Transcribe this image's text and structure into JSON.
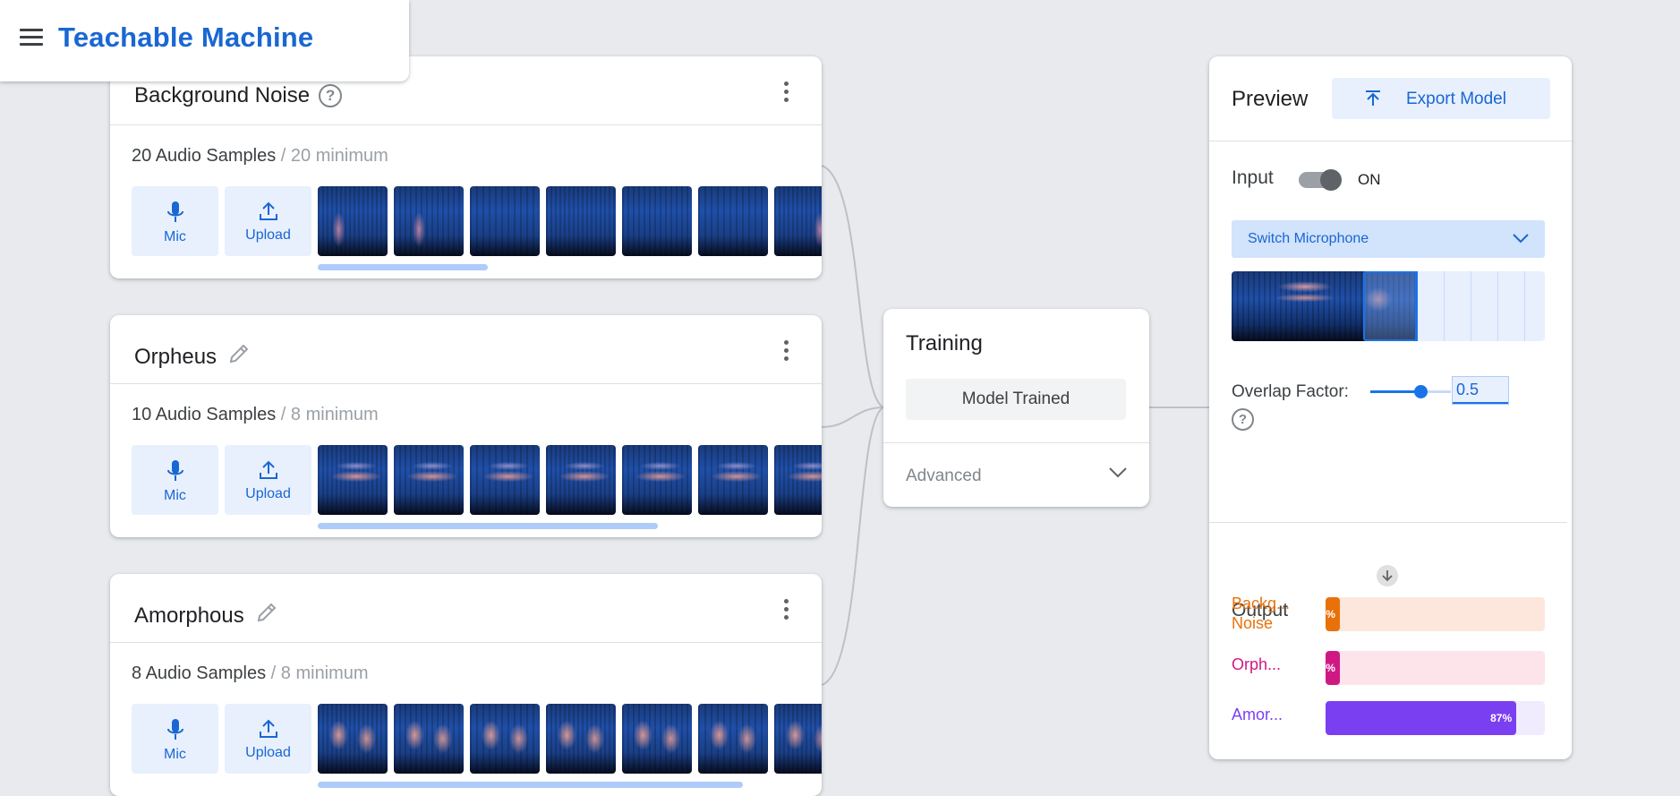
{
  "app": {
    "title": "Teachable Machine"
  },
  "classes": [
    {
      "name": "Background Noise",
      "icon": "help-icon",
      "count_text": "20 Audio Samples",
      "min_text": " / 20 minimum",
      "mic_label": "Mic",
      "upload_label": "Upload",
      "theme": "noise"
    },
    {
      "name": "Orpheus",
      "icon": "pencil-icon",
      "count_text": "10 Audio Samples",
      "min_text": " / 8 minimum",
      "mic_label": "Mic",
      "upload_label": "Upload",
      "theme": "voice"
    },
    {
      "name": "Amorphous",
      "icon": "pencil-icon",
      "count_text": "8 Audio Samples",
      "min_text": " / 8 minimum",
      "mic_label": "Mic",
      "upload_label": "Upload",
      "theme": "voice2"
    }
  ],
  "training": {
    "title": "Training",
    "status_button": "Model Trained",
    "advanced_label": "Advanced"
  },
  "preview": {
    "title": "Preview",
    "export_label": "Export Model",
    "input_label": "Input",
    "input_state": "ON",
    "microphone_select": "Switch Microphone",
    "overlap_label": "Overlap Factor:",
    "overlap_value": "0.5",
    "output_label": "Output",
    "outputs": [
      {
        "name": "Backg... Noise",
        "value_text": "%",
        "fraction": 0.05,
        "color": "#e8710a",
        "bg": "#fde7dc"
      },
      {
        "name": "Orph...",
        "value_text": "%",
        "fraction": 0.04,
        "color": "#d01884",
        "bg": "#fce4ea"
      },
      {
        "name": "Amor...",
        "value_text": "87%",
        "fraction": 0.87,
        "color": "#7b3ff2",
        "bg": "#f1ebfe"
      }
    ]
  },
  "colors": {
    "accent": "#1967d2",
    "accent_light": "#e8f0fe",
    "background": "#e8eaed"
  }
}
